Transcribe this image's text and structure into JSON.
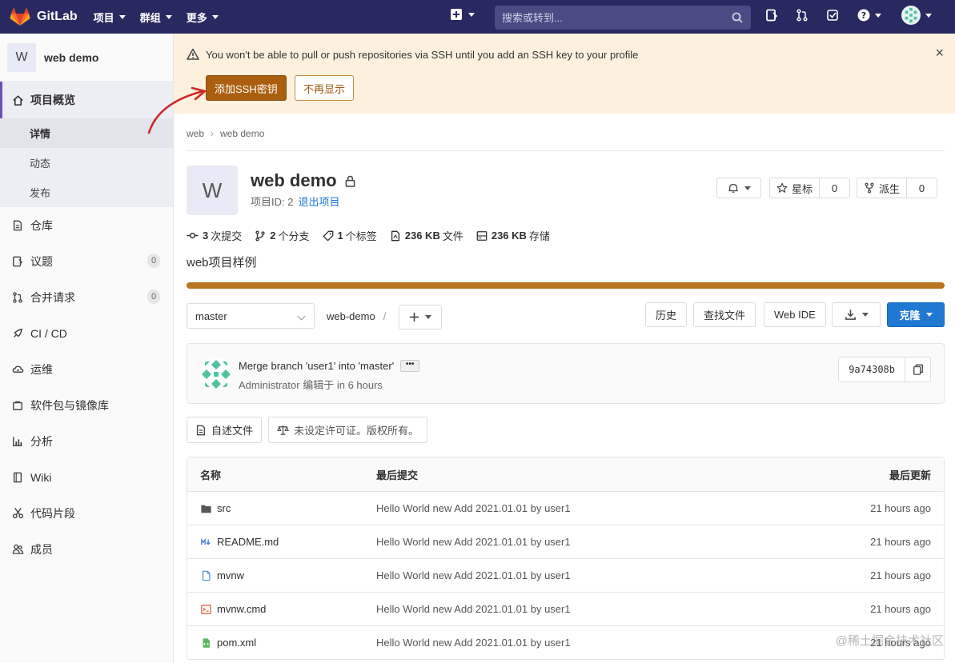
{
  "navbar": {
    "brand": "GitLab",
    "menu": [
      {
        "label": "项目"
      },
      {
        "label": "群组"
      },
      {
        "label": "更多"
      }
    ],
    "search_placeholder": "搜索或转到..."
  },
  "sidebar": {
    "project_initial": "W",
    "project_name": "web demo",
    "items": [
      {
        "label": "项目概览"
      },
      {
        "label": "仓库"
      },
      {
        "label": "议题",
        "count": "0"
      },
      {
        "label": "合并请求",
        "count": "0"
      },
      {
        "label": "CI / CD"
      },
      {
        "label": "运维"
      },
      {
        "label": "软件包与镜像库"
      },
      {
        "label": "分析"
      },
      {
        "label": "Wiki"
      },
      {
        "label": "代码片段"
      },
      {
        "label": "成员"
      }
    ],
    "subitems": [
      {
        "label": "详情"
      },
      {
        "label": "动态"
      },
      {
        "label": "发布"
      }
    ]
  },
  "alert": {
    "message": "You won't be able to pull or push repositories via SSH until you add an SSH key to your profile",
    "primary_button": "添加SSH密钥",
    "secondary_button": "不再显示",
    "close": "×"
  },
  "breadcrumb": {
    "parent": "web",
    "current": "web demo"
  },
  "project": {
    "initial": "W",
    "title": "web demo",
    "id_label": "项目ID: 2",
    "leave_link": "退出项目",
    "star_label": "星标",
    "star_count": "0",
    "fork_label": "派生",
    "fork_count": "0",
    "description": "web项目样例"
  },
  "stats": {
    "commits_num": "3",
    "commits_label": "次提交",
    "branches_num": "2",
    "branches_label": "个分支",
    "tags_num": "1",
    "tags_label": "个标签",
    "files_num": "236 KB",
    "files_label": "文件",
    "storage_num": "236 KB",
    "storage_label": "存储"
  },
  "language_bar": {
    "fill_percent": 100,
    "color": "#b8741f"
  },
  "toolbar": {
    "branch": "master",
    "repo_name": "web-demo",
    "slash": "/",
    "history": "历史",
    "find_file": "查找文件",
    "web_ide": "Web IDE",
    "clone": "克隆"
  },
  "commit": {
    "title": "Merge branch 'user1' into 'master'",
    "author": "Administrator",
    "edited": "编辑于",
    "time": "in 6 hours",
    "sha": "9a74308b",
    "ellipsis": "•••"
  },
  "file_buttons": {
    "readme": "自述文件",
    "license": "未设定许可证。版权所有。"
  },
  "file_table": {
    "headers": {
      "name": "名称",
      "last_commit": "最后提交",
      "last_update": "最后更新"
    },
    "rows": [
      {
        "name": "src",
        "icon": "folder-icon",
        "commit": "Hello World new Add 2021.01.01 by user1",
        "updated": "21 hours ago"
      },
      {
        "name": "README.md",
        "icon": "markdown-icon",
        "commit": "Hello World new Add 2021.01.01 by user1",
        "updated": "21 hours ago"
      },
      {
        "name": "mvnw",
        "icon": "file-icon",
        "commit": "Hello World new Add 2021.01.01 by user1",
        "updated": "21 hours ago"
      },
      {
        "name": "mvnw.cmd",
        "icon": "terminal-file-icon",
        "commit": "Hello World new Add 2021.01.01 by user1",
        "updated": "21 hours ago"
      },
      {
        "name": "pom.xml",
        "icon": "xml-file-icon",
        "commit": "Hello World new Add 2021.01.01 by user1",
        "updated": "21 hours ago"
      }
    ]
  },
  "watermark": "@稀土掘金技术社区",
  "colors": {
    "navbar": "#292961",
    "accent": "#1f78d1",
    "warning": "#ab5e0e",
    "alert_bg": "#fdf1de"
  }
}
